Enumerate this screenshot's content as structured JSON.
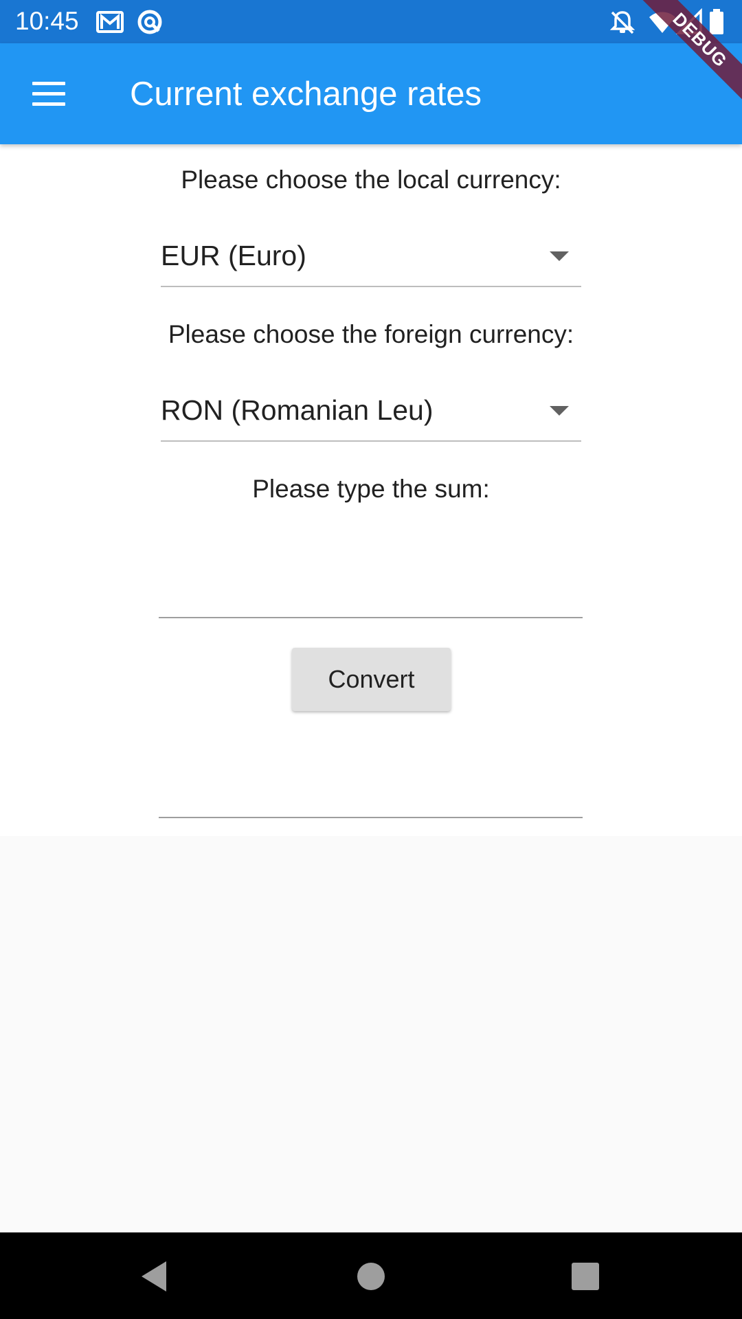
{
  "status_bar": {
    "time": "10:45",
    "icons": [
      "gmail-icon",
      "sync-icon",
      "notifications-off-icon",
      "wifi-icon",
      "signal-icon",
      "battery-icon"
    ]
  },
  "debug_banner": "DEBUG",
  "app_bar": {
    "menu_icon": "menu-icon",
    "title": "Current exchange rates",
    "color": "#2196F3"
  },
  "form": {
    "local_label": "Please choose the local currency:",
    "local_value": "EUR (Euro)",
    "foreign_label": "Please choose the foreign currency:",
    "foreign_value": "RON (Romanian Leu)",
    "sum_label": "Please type the sum:",
    "sum_value": "",
    "convert_label": "Convert",
    "result_value": ""
  },
  "nav_bar": {
    "icons": [
      "back-icon",
      "home-icon",
      "recents-icon"
    ]
  }
}
